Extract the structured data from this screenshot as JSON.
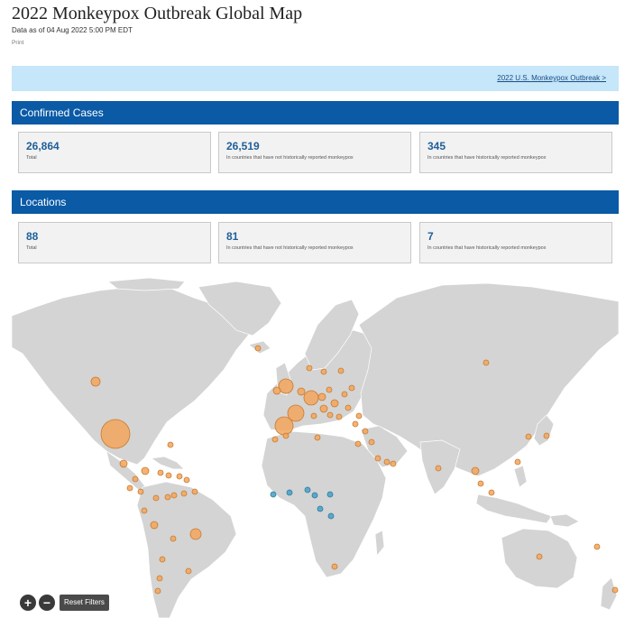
{
  "header": {
    "title": "2022 Monkeypox Outbreak Global Map",
    "as_of": "Data as of 04 Aug 2022 5:00 PM EDT",
    "print": "Print"
  },
  "banner": {
    "link": "2022 U.S. Monkeypox Outbreak >"
  },
  "confirmed": {
    "title": "Confirmed Cases",
    "cards": [
      {
        "value": "26,864",
        "caption": "Total"
      },
      {
        "value": "26,519",
        "caption": "In countries that have not historically reported monkeypox"
      },
      {
        "value": "345",
        "caption": "In countries that have historically reported monkeypox"
      }
    ]
  },
  "locations": {
    "title": "Locations",
    "cards": [
      {
        "value": "88",
        "caption": "Total"
      },
      {
        "value": "81",
        "caption": "In countries that have not historically reported monkeypox"
      },
      {
        "value": "7",
        "caption": "In countries that have historically reported monkeypox"
      }
    ]
  },
  "map_controls": {
    "zoom_in": "+",
    "zoom_out": "−",
    "reset": "Reset Filters"
  },
  "colors": {
    "non_historical": "#f2a55c",
    "historical": "#4ea3c8",
    "section_bar": "#0a5aa6"
  }
}
